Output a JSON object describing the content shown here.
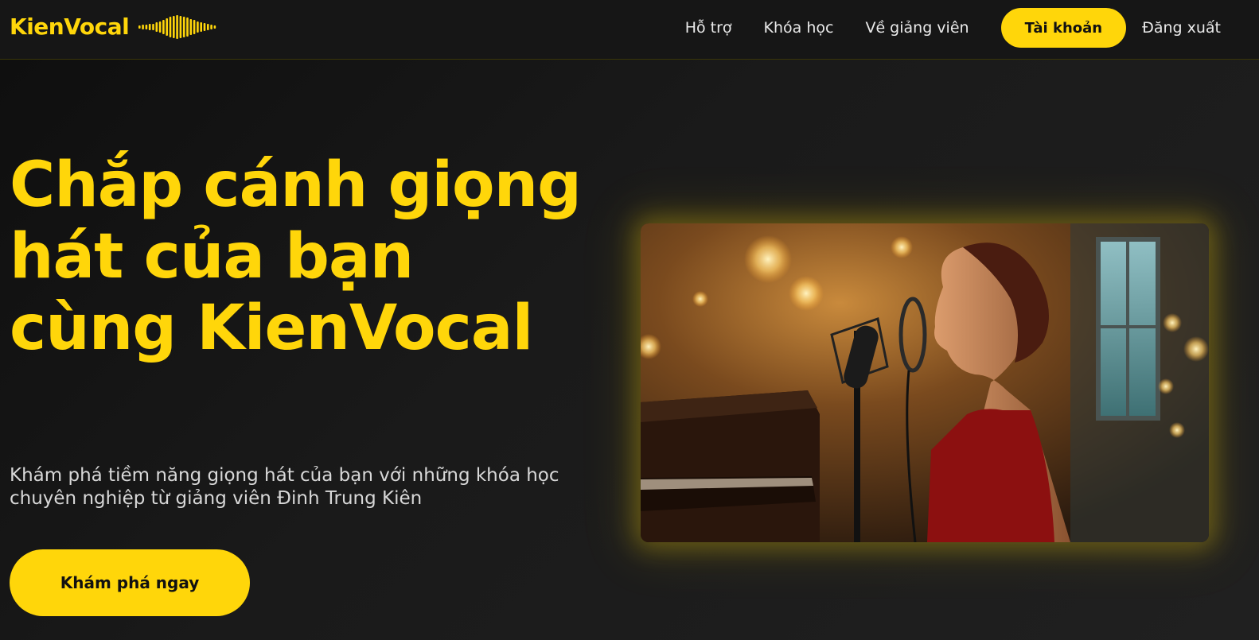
{
  "brand": {
    "name": "KienVocal",
    "accent_color": "#ffd60a",
    "logo_icon": "soundwave-icon"
  },
  "nav": {
    "items": [
      {
        "label": "Hỗ trợ"
      },
      {
        "label": "Khóa học"
      },
      {
        "label": "Về giảng viên"
      }
    ],
    "account_label": "Tài khoản",
    "logout_label": "Đăng xuất"
  },
  "hero": {
    "title": "Chắp cánh giọng hát của bạn cùng KienVocal",
    "subtitle": "Khám phá tiềm năng giọng hát của bạn với những khóa học chuyên nghiệp từ giảng viên Đinh Trung Kiên",
    "cta_label": "Khám phá ngay",
    "image": "singer-studio-photo"
  }
}
